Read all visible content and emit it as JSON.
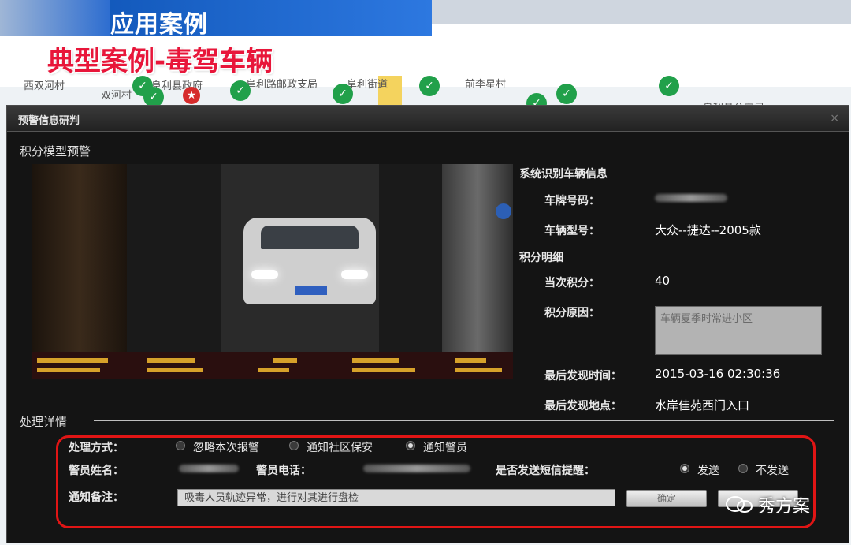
{
  "slide": {
    "section_title": "应用案例",
    "case_title": "典型案例-毒驾车辆"
  },
  "map": {
    "labels": [
      "西双河村",
      "双河村",
      "阜利县政府",
      "阜利路邮政支局",
      "阜利街道",
      "前李星村",
      "阜利县公安局"
    ]
  },
  "dialog": {
    "title": "预警信息研判",
    "close_symbol": "×",
    "model_section": "积分模型预警",
    "vehicle_section": "系统识别车辆信息",
    "plate_label": "车牌号码：",
    "model_label": "车辆型号：",
    "model_value": "大众--捷达--2005款",
    "score_section": "积分明细",
    "current_score_label": "当次积分：",
    "current_score_value": "40",
    "reason_label": "积分原因：",
    "reason_value": "车辆夏季时常进小区",
    "last_time_label": "最后发现时间：",
    "last_time_value": "2015-03-16 02:30:36",
    "last_place_label": "最后发现地点：",
    "last_place_value": "水岸佳苑西门入口",
    "handle_section": "处理详情",
    "method_label": "处理方式：",
    "methods": [
      "忽略本次报警",
      "通知社区保安",
      "通知警员"
    ],
    "selected_method": "通知警员",
    "officer_name_label": "警员姓名：",
    "officer_phone_label": "警员电话：",
    "sms_label": "是否发送短信提醒：",
    "sms_options": [
      "发送",
      "不发送"
    ],
    "note_label": "通知备注：",
    "note_value": "吸毒人员轨迹异常，进行对其进行盘检",
    "confirm_button": "确定"
  },
  "watermark": {
    "text": "秀方案"
  },
  "colors": {
    "header_blue": "#0a4fb0",
    "case_title_red": "#e8163a",
    "frame_red": "#e01515",
    "pin_green": "#21a04a"
  }
}
